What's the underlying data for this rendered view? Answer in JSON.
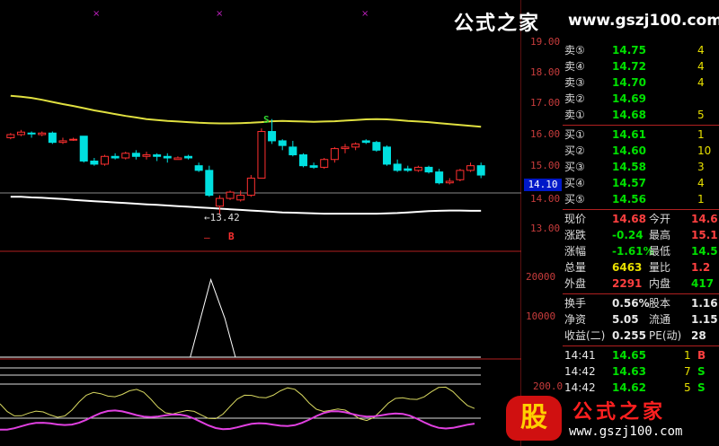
{
  "watermark_top": {
    "cn": "公式之家",
    "url": "www.gszj100.com"
  },
  "watermark_bottom": {
    "badge": "股",
    "cn": "公式之家",
    "url": "www.gszj100.com"
  },
  "price_axis": {
    "labels": [
      "19.00",
      "18.00",
      "17.00",
      "16.00",
      "15.00",
      "14.00",
      "13.00"
    ]
  },
  "current_price_tag": "14.10",
  "volume_axis": {
    "labels": [
      "20000",
      "10000"
    ]
  },
  "indicator_axis": {
    "labels": [
      "200.0"
    ]
  },
  "annotations": {
    "low_marker": "13.42",
    "s_marker": "S",
    "b_marker": "B",
    "dash_marker": "–"
  },
  "order_book": {
    "asks": [
      {
        "label": "卖⑤",
        "price": "14.75",
        "vol": "4"
      },
      {
        "label": "卖④",
        "price": "14.72",
        "vol": "4"
      },
      {
        "label": "卖③",
        "price": "14.70",
        "vol": "4"
      },
      {
        "label": "卖②",
        "price": "14.69",
        "vol": ""
      },
      {
        "label": "卖①",
        "price": "14.68",
        "vol": "5"
      }
    ],
    "bids": [
      {
        "label": "买①",
        "price": "14.61",
        "vol": "1"
      },
      {
        "label": "买②",
        "price": "14.60",
        "vol": "10"
      },
      {
        "label": "买③",
        "price": "14.58",
        "vol": "3"
      },
      {
        "label": "买④",
        "price": "14.57",
        "vol": "4"
      },
      {
        "label": "买⑤",
        "price": "14.56",
        "vol": "1"
      }
    ]
  },
  "quote": [
    {
      "k1": "现价",
      "v1": "14.68",
      "c1": "red",
      "k2": "今开",
      "v2": "14.6",
      "c2": "red"
    },
    {
      "k1": "涨跌",
      "v1": "-0.24",
      "c1": "green",
      "k2": "最高",
      "v2": "15.1",
      "c2": "red"
    },
    {
      "k1": "涨幅",
      "v1": "-1.61%",
      "c1": "green",
      "k2": "最低",
      "v2": "14.5",
      "c2": "green"
    },
    {
      "k1": "总量",
      "v1": "6463",
      "c1": "yellow",
      "k2": "量比",
      "v2": "1.2",
      "c2": "red"
    },
    {
      "k1": "外盘",
      "v1": "2291",
      "c1": "red",
      "k2": "内盘",
      "v2": "417",
      "c2": "green"
    }
  ],
  "stats": [
    {
      "k1": "换手",
      "v1": "0.56%",
      "k2": "股本",
      "v2": "1.16"
    },
    {
      "k1": "净资",
      "v1": "5.05",
      "k2": "流通",
      "v2": "1.15"
    },
    {
      "k1": "收益(二)",
      "v1": "0.255",
      "k2": "PE(动)",
      "v2": "28"
    }
  ],
  "ticks": [
    {
      "time": "14:41",
      "price": "14.65",
      "vol": "1",
      "side": "B",
      "side_color": "red"
    },
    {
      "time": "14:42",
      "price": "14.63",
      "vol": "7",
      "side": "S",
      "side_color": "green"
    },
    {
      "time": "14:42",
      "price": "14.62",
      "vol": "5",
      "side": "S",
      "side_color": "green"
    }
  ],
  "colors": {
    "up": "#ff3030",
    "down": "#00e0e0",
    "ma_upper": "#e0e040",
    "ma_lower": "#ffffff",
    "grid": "#b02020"
  },
  "chart_data": {
    "type": "candlestick",
    "price_ylim": [
      13.0,
      19.0
    ],
    "candles": [
      {
        "o": 15.9,
        "h": 16.05,
        "c": 16.0,
        "l": 15.85
      },
      {
        "o": 16.0,
        "h": 16.15,
        "c": 16.08,
        "l": 15.95
      },
      {
        "o": 16.05,
        "h": 16.1,
        "c": 16.02,
        "l": 15.9
      },
      {
        "o": 16.0,
        "h": 16.1,
        "c": 16.05,
        "l": 15.95
      },
      {
        "o": 16.05,
        "h": 16.1,
        "c": 15.75,
        "l": 15.7
      },
      {
        "o": 15.75,
        "h": 15.9,
        "c": 15.8,
        "l": 15.7
      },
      {
        "o": 15.85,
        "h": 15.9,
        "c": 15.85,
        "l": 15.8
      },
      {
        "o": 15.95,
        "h": 15.95,
        "c": 15.15,
        "l": 15.1
      },
      {
        "o": 15.15,
        "h": 15.25,
        "c": 15.05,
        "l": 15.0
      },
      {
        "o": 15.05,
        "h": 15.35,
        "c": 15.3,
        "l": 15.0
      },
      {
        "o": 15.3,
        "h": 15.4,
        "c": 15.25,
        "l": 15.2
      },
      {
        "o": 15.25,
        "h": 15.45,
        "c": 15.4,
        "l": 15.2
      },
      {
        "o": 15.4,
        "h": 15.5,
        "c": 15.3,
        "l": 15.2
      },
      {
        "o": 15.3,
        "h": 15.45,
        "c": 15.35,
        "l": 15.2
      },
      {
        "o": 15.35,
        "h": 15.4,
        "c": 15.3,
        "l": 15.15
      },
      {
        "o": 15.3,
        "h": 15.4,
        "c": 15.25,
        "l": 15.1
      },
      {
        "o": 15.2,
        "h": 15.3,
        "c": 15.25,
        "l": 15.2
      },
      {
        "o": 15.3,
        "h": 15.35,
        "c": 15.25,
        "l": 15.2
      },
      {
        "o": 15.0,
        "h": 15.1,
        "c": 14.85,
        "l": 14.8
      },
      {
        "o": 14.85,
        "h": 15.0,
        "c": 14.05,
        "l": 14.0
      },
      {
        "o": 13.7,
        "h": 14.05,
        "c": 13.95,
        "l": 13.42
      },
      {
        "o": 13.95,
        "h": 14.2,
        "c": 14.15,
        "l": 13.9
      },
      {
        "o": 13.9,
        "h": 14.2,
        "c": 14.05,
        "l": 13.85
      },
      {
        "o": 14.05,
        "h": 14.7,
        "c": 14.6,
        "l": 14.0
      },
      {
        "o": 14.6,
        "h": 16.2,
        "c": 16.1,
        "l": 14.6
      },
      {
        "o": 16.1,
        "h": 16.5,
        "c": 15.8,
        "l": 15.7
      },
      {
        "o": 15.8,
        "h": 15.85,
        "c": 15.65,
        "l": 15.5
      },
      {
        "o": 15.6,
        "h": 15.8,
        "c": 15.35,
        "l": 15.3
      },
      {
        "o": 15.35,
        "h": 15.4,
        "c": 15.0,
        "l": 14.95
      },
      {
        "o": 15.0,
        "h": 15.1,
        "c": 14.95,
        "l": 14.9
      },
      {
        "o": 14.95,
        "h": 15.25,
        "c": 15.2,
        "l": 14.9
      },
      {
        "o": 15.2,
        "h": 15.6,
        "c": 15.55,
        "l": 15.1
      },
      {
        "o": 15.55,
        "h": 15.7,
        "c": 15.6,
        "l": 15.4
      },
      {
        "o": 15.6,
        "h": 15.75,
        "c": 15.7,
        "l": 15.5
      },
      {
        "o": 15.8,
        "h": 15.85,
        "c": 15.75,
        "l": 15.7
      },
      {
        "o": 15.75,
        "h": 15.8,
        "c": 15.5,
        "l": 15.45
      },
      {
        "o": 15.6,
        "h": 15.65,
        "c": 15.05,
        "l": 15.0
      },
      {
        "o": 15.05,
        "h": 15.2,
        "c": 14.85,
        "l": 14.8
      },
      {
        "o": 14.9,
        "h": 15.0,
        "c": 14.85,
        "l": 14.8
      },
      {
        "o": 14.85,
        "h": 15.0,
        "c": 14.95,
        "l": 14.8
      },
      {
        "o": 14.95,
        "h": 15.0,
        "c": 14.8,
        "l": 14.75
      },
      {
        "o": 14.8,
        "h": 14.9,
        "c": 14.45,
        "l": 14.4
      },
      {
        "o": 14.45,
        "h": 14.6,
        "c": 14.5,
        "l": 14.4
      },
      {
        "o": 14.55,
        "h": 14.9,
        "c": 14.85,
        "l": 14.5
      },
      {
        "o": 14.85,
        "h": 15.1,
        "c": 15.0,
        "l": 14.8
      },
      {
        "o": 15.0,
        "h": 15.1,
        "c": 14.7,
        "l": 14.6
      }
    ],
    "ma_upper": [
      17.25,
      17.22,
      17.18,
      17.12,
      17.05,
      16.98,
      16.92,
      16.85,
      16.78,
      16.72,
      16.66,
      16.6,
      16.55,
      16.5,
      16.47,
      16.44,
      16.42,
      16.4,
      16.38,
      16.37,
      16.36,
      16.36,
      16.37,
      16.38,
      16.4,
      16.43,
      16.44,
      16.43,
      16.42,
      16.41,
      16.42,
      16.43,
      16.45,
      16.47,
      16.49,
      16.5,
      16.49,
      16.47,
      16.44,
      16.42,
      16.4,
      16.37,
      16.34,
      16.31,
      16.28,
      16.25
    ],
    "ma_lower": [
      14.0,
      14.0,
      13.98,
      13.97,
      13.95,
      13.93,
      13.9,
      13.88,
      13.86,
      13.84,
      13.82,
      13.8,
      13.78,
      13.76,
      13.74,
      13.72,
      13.7,
      13.68,
      13.66,
      13.64,
      13.62,
      13.6,
      13.58,
      13.56,
      13.54,
      13.52,
      13.5,
      13.49,
      13.48,
      13.47,
      13.46,
      13.46,
      13.46,
      13.46,
      13.46,
      13.46,
      13.47,
      13.48,
      13.5,
      13.52,
      13.54,
      13.55,
      13.56,
      13.56,
      13.55,
      13.55
    ],
    "volume_ylim": [
      0,
      25000
    ],
    "volume_x": [
      0,
      17,
      20,
      21,
      22,
      46
    ],
    "volume_values": [
      0,
      0,
      20000,
      10000,
      0,
      0
    ]
  }
}
